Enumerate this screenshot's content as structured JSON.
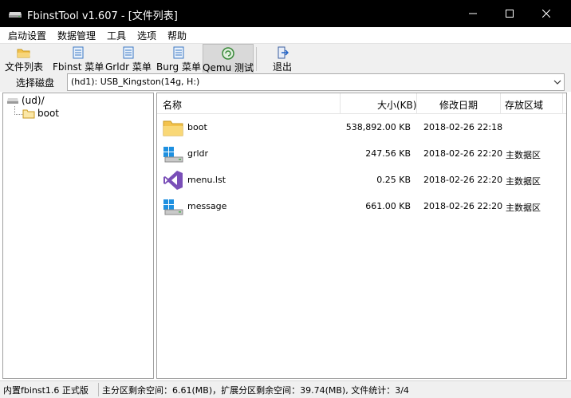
{
  "window": {
    "title": "FbinstTool v1.607 - [文件列表]",
    "app_icon": "drive-icon",
    "controls": [
      "minimize-icon",
      "maximize-icon",
      "close-icon"
    ]
  },
  "menu": {
    "items": [
      "启动设置",
      "数据管理",
      "工具",
      "选项",
      "帮助"
    ]
  },
  "toolbar": {
    "buttons": [
      {
        "label": "文件列表",
        "icon": "folder-icon"
      },
      {
        "label": "Fbinst 菜单",
        "icon": "document-icon"
      },
      {
        "label": "Grldr 菜单",
        "icon": "document-icon"
      },
      {
        "label": "Burg 菜单",
        "icon": "document-icon"
      },
      {
        "label": "Qemu 测试",
        "icon": "qemu-icon"
      },
      {
        "label": "退出",
        "icon": "exit-icon"
      }
    ]
  },
  "disk": {
    "label": "选择磁盘",
    "selected": "(hd1): USB_Kingston(14g, H:)"
  },
  "tree": {
    "root": "(ud)/",
    "children": [
      "boot"
    ]
  },
  "list": {
    "columns": [
      "名称",
      "大小(KB)",
      "修改日期",
      "存放区域"
    ],
    "rows": [
      {
        "name": "boot",
        "size": "538,892.00 KB",
        "date": "2018-02-26 22:18",
        "area": "",
        "icon": "folder-icon"
      },
      {
        "name": "grldr",
        "size": "247.56 KB",
        "date": "2018-02-26 22:20",
        "area": "主数据区",
        "icon": "windows-file-icon"
      },
      {
        "name": "menu.lst",
        "size": "0.25 KB",
        "date": "2018-02-26 22:20",
        "area": "主数据区",
        "icon": "visual-studio-icon"
      },
      {
        "name": "message",
        "size": "661.00 KB",
        "date": "2018-02-26 22:20",
        "area": "主数据区",
        "icon": "windows-file-icon"
      }
    ]
  },
  "status": {
    "left": "内置fbinst1.6 正式版",
    "right": "主分区剩余空间：6.61(MB)，扩展分区剩余空间：39.74(MB), 文件统计：3/4"
  },
  "colors": {
    "titlebar": "#000000",
    "toolbar": "#f0f0f0",
    "folder": "#f3c24c",
    "windows_blue": "#1e90e0",
    "visual_studio": "#7a4fb8",
    "qemu_green": "#3a8a3a"
  }
}
